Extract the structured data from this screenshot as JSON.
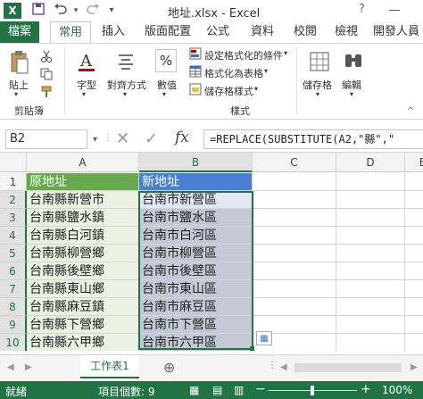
{
  "window": {
    "title": "地址.xlsx - Excel",
    "help_label": "?"
  },
  "tabs": {
    "file": "檔案",
    "home": "常用",
    "insert": "插入",
    "layout": "版面配置",
    "formulas": "公式",
    "data": "資料",
    "review": "校閱",
    "view": "檢視",
    "developer": "開發人員"
  },
  "ribbon": {
    "paste": "貼上",
    "clipboard_group": "剪貼簿",
    "font": "字型",
    "alignment": "對齊方式",
    "number": "數值",
    "percent_symbol": "%",
    "conditional_format": "設定格式化的條件",
    "format_as_table": "格式化為表格",
    "cell_styles": "儲存格樣式",
    "styles_group": "樣式",
    "cells": "儲存格",
    "editing": "編輯"
  },
  "formula_bar": {
    "name_box": "B2",
    "fx": "fx",
    "formula": "=REPLACE(SUBSTITUTE(A2,\"縣\",\""
  },
  "grid": {
    "columns": [
      "A",
      "B",
      "C",
      "D",
      "E"
    ],
    "rows": [
      "1",
      "2",
      "3",
      "4",
      "5",
      "6",
      "7",
      "8",
      "9",
      "10"
    ],
    "header_a": "原地址",
    "header_b": "新地址",
    "original": [
      "台南縣新營市",
      "台南縣鹽水鎮",
      "台南縣白河鎮",
      "台南縣柳營鄉",
      "台南縣後壁鄉",
      "台南縣東山鄉",
      "台南縣麻豆鎮",
      "台南縣下營鄉",
      "台南縣六甲鄉"
    ],
    "converted": [
      "台南市新營區",
      "台南市鹽水區",
      "台南市白河區",
      "台南市柳營區",
      "台南市後壁區",
      "台南市東山區",
      "台南市麻豆區",
      "台南市下營區",
      "台南市六甲區"
    ],
    "colors": {
      "header_a_fill": "#6aa84f",
      "header_b_fill": "#4a7fd4",
      "col_a_fill": "#e9f2e3",
      "col_b_fill": "#c5c9d6",
      "col_b_active_fill": "#e3e7f4",
      "selection_border": "#217346"
    }
  },
  "sheets": {
    "active": "工作表1",
    "add_label": "⊕"
  },
  "status": {
    "ready": "就緒",
    "count": "項目個數: 9",
    "zoom": "100%",
    "zoom_minus": "−",
    "zoom_plus": "+"
  }
}
